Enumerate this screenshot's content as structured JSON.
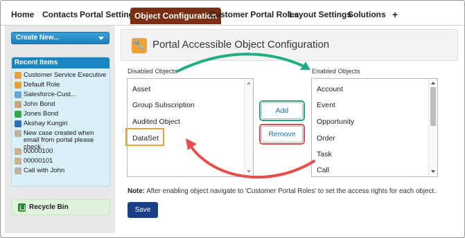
{
  "tabs": [
    {
      "label": "Home"
    },
    {
      "label": "Contacts"
    },
    {
      "label": "Portal Settings"
    },
    {
      "label": "Object Configuration",
      "active": true
    },
    {
      "label": "Customer Portal Roles"
    },
    {
      "label": "Layout Settings"
    },
    {
      "label": "Solutions"
    },
    {
      "label": "+"
    }
  ],
  "sidebar": {
    "create_new": "Create New...",
    "recent_title": "Recent Items",
    "recent_items": [
      {
        "label": "Customer Service Executive",
        "icon": "role-icon"
      },
      {
        "label": "Default Role",
        "icon": "role-icon"
      },
      {
        "label": "Salesforce-Cust...",
        "icon": "site-icon"
      },
      {
        "label": "John Bond",
        "icon": "contact-icon"
      },
      {
        "label": "Jones Bond",
        "icon": "account-icon"
      },
      {
        "label": "Akshay Kungiri",
        "icon": "user-icon"
      },
      {
        "label": "New case created when email from portal please check.",
        "icon": "email-icon"
      },
      {
        "label": "00000100",
        "icon": "case-icon"
      },
      {
        "label": "00000101",
        "icon": "case-icon"
      },
      {
        "label": "Call with John",
        "icon": "task-icon"
      }
    ],
    "recycle_bin": "Recycle Bin"
  },
  "page": {
    "title": "Portal Accessible Object Configuration",
    "disabled_label": "Disabled Objects",
    "enabled_label": "Enabled Objects",
    "disabled_objects": [
      "Asset",
      "Group Subscription",
      "Audited Object",
      "DataSet"
    ],
    "enabled_objects": [
      "Account",
      "Event",
      "Opportunity",
      "Order",
      "Task",
      "Call"
    ],
    "add_label": "Add",
    "remove_label": "Remove",
    "note_bold": "Note:",
    "note_text": " After enabling object navigate to 'Customer Portal Roles' to set the access rights for each object.",
    "save_label": "Save"
  },
  "colors": {
    "active_tab": "#7a2f14",
    "create_button": "#1c7fbf",
    "save_button": "#1a3f86",
    "green_arrow": "#1fae84",
    "red_arrow": "#e84d4d",
    "highlight_orange": "#f2a328"
  }
}
